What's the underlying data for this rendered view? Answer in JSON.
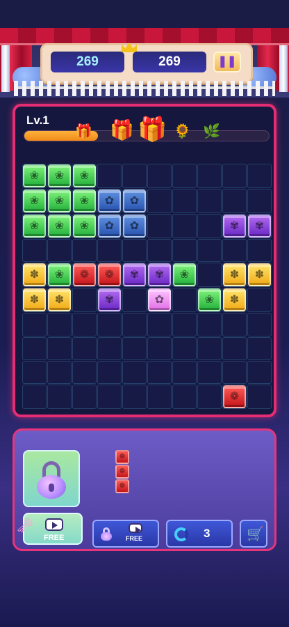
{
  "header": {
    "best_score": "269",
    "current_score": "269",
    "pause_icon": "pause-icon",
    "crown_icon": "crown-icon"
  },
  "board": {
    "level_label": "Lv.1",
    "progress": 0.3,
    "rewards": [
      "gift-box-icon",
      "gift-box-icon",
      "gift-box-icon",
      "sunflower-icon",
      "plant-icon"
    ],
    "rows": [
      [
        "green",
        "green",
        "green",
        "",
        "",
        "",
        "",
        "",
        "",
        ""
      ],
      [
        "green",
        "green",
        "green",
        "blue",
        "blue",
        "",
        "",
        "",
        "",
        ""
      ],
      [
        "green",
        "green",
        "green",
        "blue",
        "blue",
        "",
        "",
        "",
        "purple",
        "purple"
      ],
      [
        "",
        "",
        "",
        "",
        "",
        "",
        "",
        "",
        "",
        ""
      ],
      [
        "yellow",
        "green",
        "red",
        "red",
        "purple",
        "purple",
        "green",
        "",
        "yellow",
        "yellow"
      ],
      [
        "yellow",
        "yellow",
        "",
        "purple",
        "",
        "pink",
        "",
        "green",
        "yellow",
        ""
      ],
      [
        "",
        "",
        "",
        "",
        "",
        "",
        "",
        "",
        "",
        ""
      ],
      [
        "",
        "",
        "",
        "",
        "",
        "",
        "",
        "",
        "",
        ""
      ],
      [
        "",
        "",
        "",
        "",
        "",
        "",
        "",
        "",
        "",
        ""
      ],
      [
        "",
        "",
        "",
        "",
        "",
        "",
        "",
        "",
        "red",
        ""
      ]
    ]
  },
  "panel": {
    "lock_icon": "padlock-icon",
    "free_label": "FREE",
    "unlock_free_label": "FREE",
    "refresh_count": "3",
    "preview_piece": [
      "red",
      "red",
      "red"
    ],
    "colors": {
      "accent_border": "#e6357b",
      "panel_bg": "#6d5cc6",
      "button_bg": "#3f57d8"
    }
  }
}
